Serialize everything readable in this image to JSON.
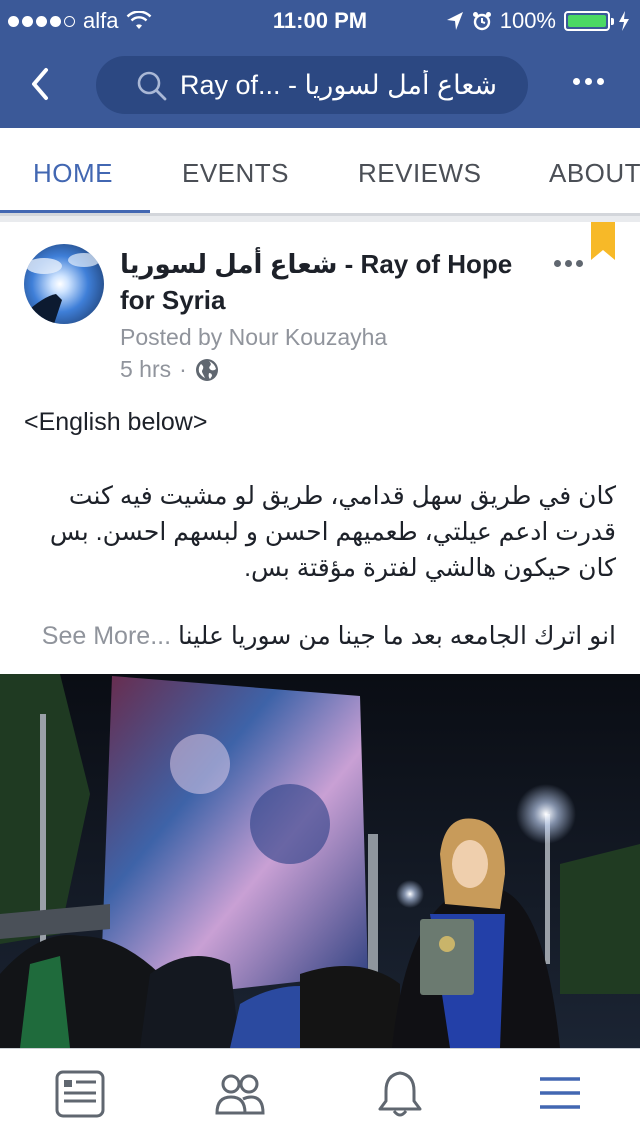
{
  "status_bar": {
    "carrier": "alfa",
    "time": "11:00 PM",
    "battery_percent": "100%"
  },
  "nav": {
    "search_title": "Ray of... - شعاع أمل لسوريا"
  },
  "tabs": [
    {
      "label": "HOME",
      "active": true
    },
    {
      "label": "EVENTS",
      "active": false
    },
    {
      "label": "REVIEWS",
      "active": false
    },
    {
      "label": "ABOUT",
      "active": false
    }
  ],
  "post": {
    "page_name_line1": "شعاع أمل لسوريا - Ray of Hope",
    "page_name_line2": "for Syria",
    "posted_by": "Posted by Nour Kouzayha",
    "time_ago": "5 hrs",
    "meta_separator": "·",
    "english_note": "<English below>",
    "arabic_paragraph": "كان في طريق سهل قدامي، طريق لو مشيت فيه كنت قدرت ادعم عيلتي، طعميهم احسن و لبسهم احسن. بس كان حيكون هالشي لفترة مؤقتة بس.",
    "last_line": "انو اترك الجامعه بعد ما جينا من سوريا علينا",
    "see_more": "See More",
    "ellipsis": "..."
  },
  "colors": {
    "facebook_blue": "#3b5998",
    "tab_active": "#4267b2",
    "bookmark": "#f7b928",
    "battery": "#4cd964"
  },
  "bottom_nav": [
    {
      "icon": "news-feed-icon"
    },
    {
      "icon": "friends-icon"
    },
    {
      "icon": "notifications-bell-icon"
    },
    {
      "icon": "menu-icon"
    }
  ]
}
